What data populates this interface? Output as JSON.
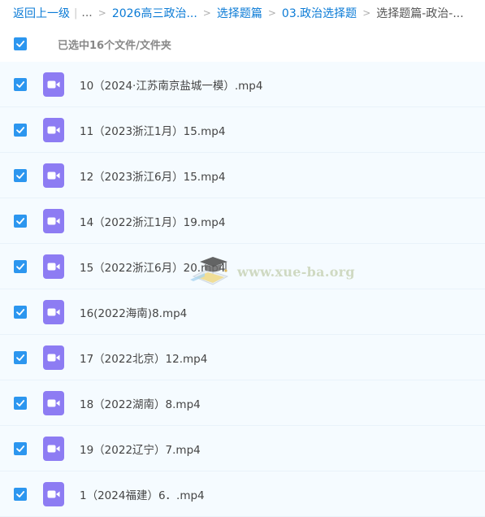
{
  "breadcrumb": {
    "back": "返回上一级",
    "ellipsis": "...",
    "items": [
      "2026高三政治...",
      "选择题篇",
      "03.政治选择题"
    ],
    "current": "选择题篇-政治-..."
  },
  "selection": {
    "label": "已选中16个文件/文件夹",
    "checked": true
  },
  "files": [
    {
      "name": "10（2024·江苏南京盐城一模）.mp4",
      "checked": true
    },
    {
      "name": "11（2023浙江1月）15.mp4",
      "checked": true
    },
    {
      "name": "12（2023浙江6月）15.mp4",
      "checked": true
    },
    {
      "name": "14（2022浙江1月）19.mp4",
      "checked": true
    },
    {
      "name": "15（2022浙江6月）20.mp4",
      "checked": true
    },
    {
      "name": "16(2022海南)8.mp4",
      "checked": true
    },
    {
      "name": "17（2022北京）12.mp4",
      "checked": true
    },
    {
      "name": "18（2022湖南）8.mp4",
      "checked": true
    },
    {
      "name": "19（2022辽宁）7.mp4",
      "checked": true
    },
    {
      "name": "1（2024福建）6．.mp4",
      "checked": true
    }
  ],
  "icons": {
    "checkbox": "checkmark-icon",
    "file": "video-file-icon"
  },
  "colors": {
    "link": "#0b7bd6",
    "checkbox": "#2c96ef",
    "video_icon": "#8d7cf3",
    "row_bg": "#f5fbff"
  },
  "watermark": {
    "text": "www.xue-ba.org"
  }
}
